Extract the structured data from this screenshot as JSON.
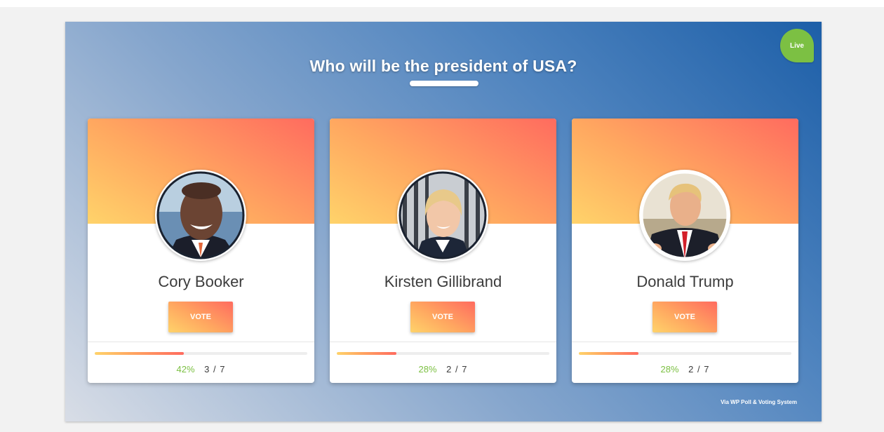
{
  "poll": {
    "title": "Who will be the president of USA?",
    "live_label": "Live",
    "credit": "Via WP Poll & Voting System",
    "vote_label": "VOTE",
    "candidates": [
      {
        "name": "Cory Booker",
        "percent": "42%",
        "votes": "3 / 7",
        "fraction": 0.42
      },
      {
        "name": "Kirsten Gillibrand",
        "percent": "28%",
        "votes": "2 / 7",
        "fraction": 0.28
      },
      {
        "name": "Donald Trump",
        "percent": "28%",
        "votes": "2 / 7",
        "fraction": 0.28
      }
    ]
  },
  "colors": {
    "accent_green": "#7cc043",
    "gradient_start": "#ffd36a",
    "gradient_end": "#ff6b5f",
    "panel_dark": "#1d5fa8"
  }
}
